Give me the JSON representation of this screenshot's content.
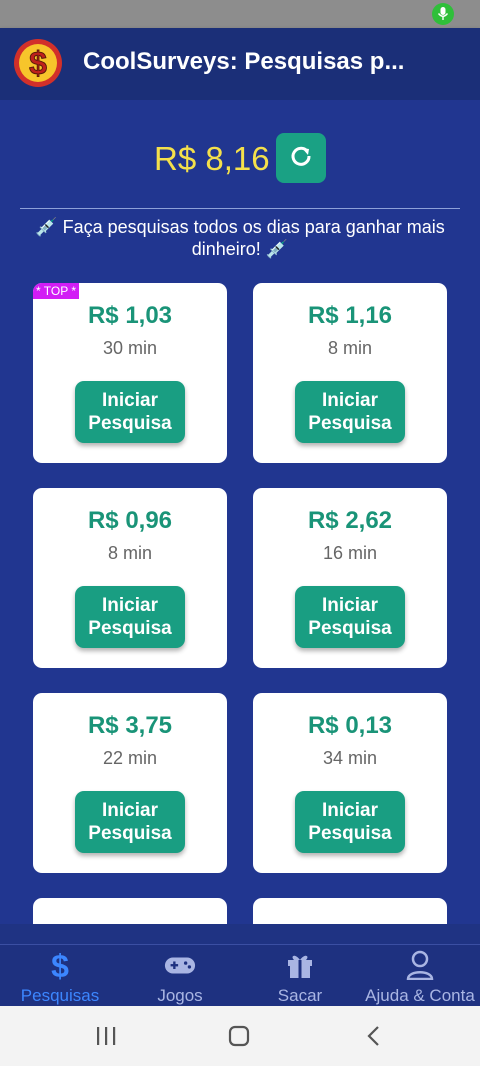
{
  "app": {
    "title": "CoolSurveys: Pesquisas p..."
  },
  "balance": {
    "amount": "R$ 8,16"
  },
  "promo": {
    "text": "💉 Faça pesquisas todos os dias para ganhar mais dinheiro! 💉"
  },
  "surveys": [
    {
      "badge": "* TOP *",
      "price": "R$ 1,03",
      "time": "30 min",
      "button": "Iniciar Pesquisa"
    },
    {
      "price": "R$ 1,16",
      "time": "8 min",
      "button": "Iniciar Pesquisa"
    },
    {
      "price": "R$ 0,96",
      "time": "8 min",
      "button": "Iniciar Pesquisa"
    },
    {
      "price": "R$ 2,62",
      "time": "16 min",
      "button": "Iniciar Pesquisa"
    },
    {
      "price": "R$ 3,75",
      "time": "22 min",
      "button": "Iniciar Pesquisa"
    },
    {
      "price": "R$ 0,13",
      "time": "34 min",
      "button": "Iniciar Pesquisa"
    }
  ],
  "nav": {
    "items": [
      {
        "label": "Pesquisas",
        "icon": "dollar-icon",
        "active": true
      },
      {
        "label": "Jogos",
        "icon": "gamepad-icon"
      },
      {
        "label": "Sacar",
        "icon": "gift-icon"
      },
      {
        "label": "Ajuda & Conta",
        "icon": "user-icon"
      }
    ]
  },
  "colors": {
    "accent": "#1a9e82",
    "balance": "#f4e04b",
    "background": "#213690",
    "badge": "#d21df5",
    "active_nav": "#3c86ff"
  }
}
